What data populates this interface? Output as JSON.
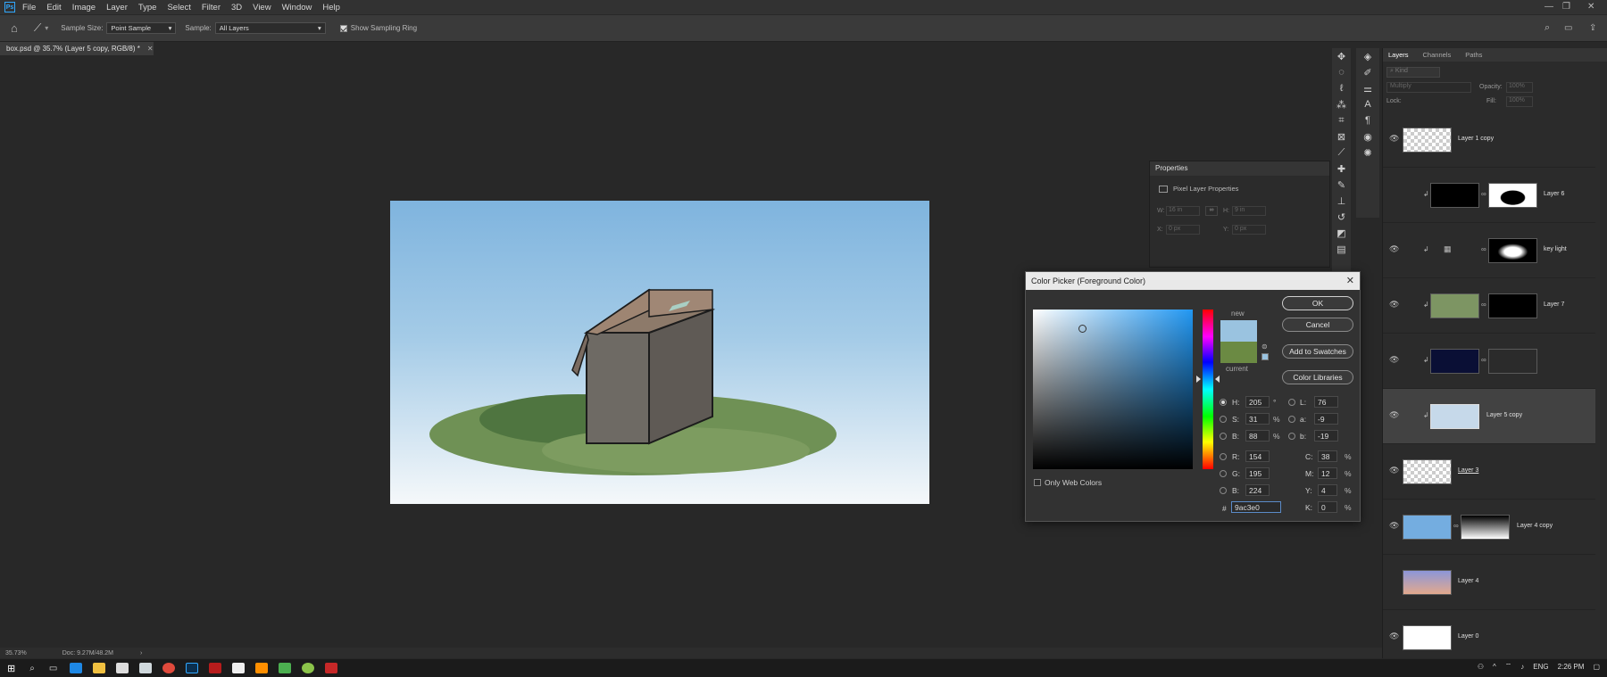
{
  "menu": {
    "items": [
      "File",
      "Edit",
      "Image",
      "Layer",
      "Type",
      "Select",
      "Filter",
      "3D",
      "View",
      "Window",
      "Help"
    ]
  },
  "options_bar": {
    "sample_size_label": "Sample Size:",
    "sample_size_value": "Point Sample",
    "sample_label": "Sample:",
    "sample_value": "All Layers",
    "show_sampling_ring_label": "Show Sampling Ring",
    "show_sampling_ring_checked": true
  },
  "document": {
    "tab_title": "box.psd @ 35.7% (Layer 5 copy, RGB/8) *"
  },
  "properties": {
    "title": "Properties",
    "subtitle": "Pixel Layer Properties",
    "w_label": "W:",
    "w_value": "16 in",
    "h_label": "H:",
    "h_value": "9 in",
    "x_label": "X:",
    "x_value": "0 px",
    "y_label": "Y:",
    "y_value": "0 px"
  },
  "color_picker": {
    "title": "Color Picker (Foreground Color)",
    "new_label": "new",
    "current_label": "current",
    "new_color": "#9ac3e0",
    "current_color": "#6b8a43",
    "ok_label": "OK",
    "cancel_label": "Cancel",
    "add_swatches_label": "Add to Swatches",
    "color_libraries_label": "Color Libraries",
    "only_web_colors_label": "Only Web Colors",
    "h": {
      "label": "H:",
      "value": "205",
      "unit": "°"
    },
    "s": {
      "label": "S:",
      "value": "31",
      "unit": "%"
    },
    "b": {
      "label": "B:",
      "value": "88",
      "unit": "%"
    },
    "r": {
      "label": "R:",
      "value": "154"
    },
    "g": {
      "label": "G:",
      "value": "195"
    },
    "bl": {
      "label": "B:",
      "value": "224"
    },
    "l": {
      "label": "L:",
      "value": "76"
    },
    "a": {
      "label": "a:",
      "value": "-9"
    },
    "lb": {
      "label": "b:",
      "value": "-19"
    },
    "c": {
      "label": "C:",
      "value": "38",
      "unit": "%"
    },
    "m": {
      "label": "M:",
      "value": "12",
      "unit": "%"
    },
    "y": {
      "label": "Y:",
      "value": "4",
      "unit": "%"
    },
    "k": {
      "label": "K:",
      "value": "0",
      "unit": "%"
    },
    "hex_label": "#",
    "hex_value": "9ac3e0"
  },
  "layers_panel": {
    "tabs": [
      "Layers",
      "Channels",
      "Paths"
    ],
    "kind_placeholder": "Kind",
    "blend_mode": "Multiply",
    "opacity_label": "Opacity:",
    "opacity_value": "100%",
    "lock_label": "Lock:",
    "fill_label": "Fill:",
    "fill_value": "100%",
    "layers": [
      {
        "name": "Layer 1 copy"
      },
      {
        "name": "Layer 6"
      },
      {
        "name": "key light"
      },
      {
        "name": "Layer 7"
      },
      {
        "name": ""
      },
      {
        "name": "Layer 5 copy"
      },
      {
        "name": "Layer 3"
      },
      {
        "name": "Layer 4 copy"
      },
      {
        "name": "Layer 4"
      },
      {
        "name": "Layer 0"
      }
    ]
  },
  "status_bar": {
    "zoom": "35.73%",
    "doc_info": "Doc: 9.27M/48.2M"
  },
  "taskbar": {
    "language": "ENG",
    "time": "2:26 PM"
  }
}
